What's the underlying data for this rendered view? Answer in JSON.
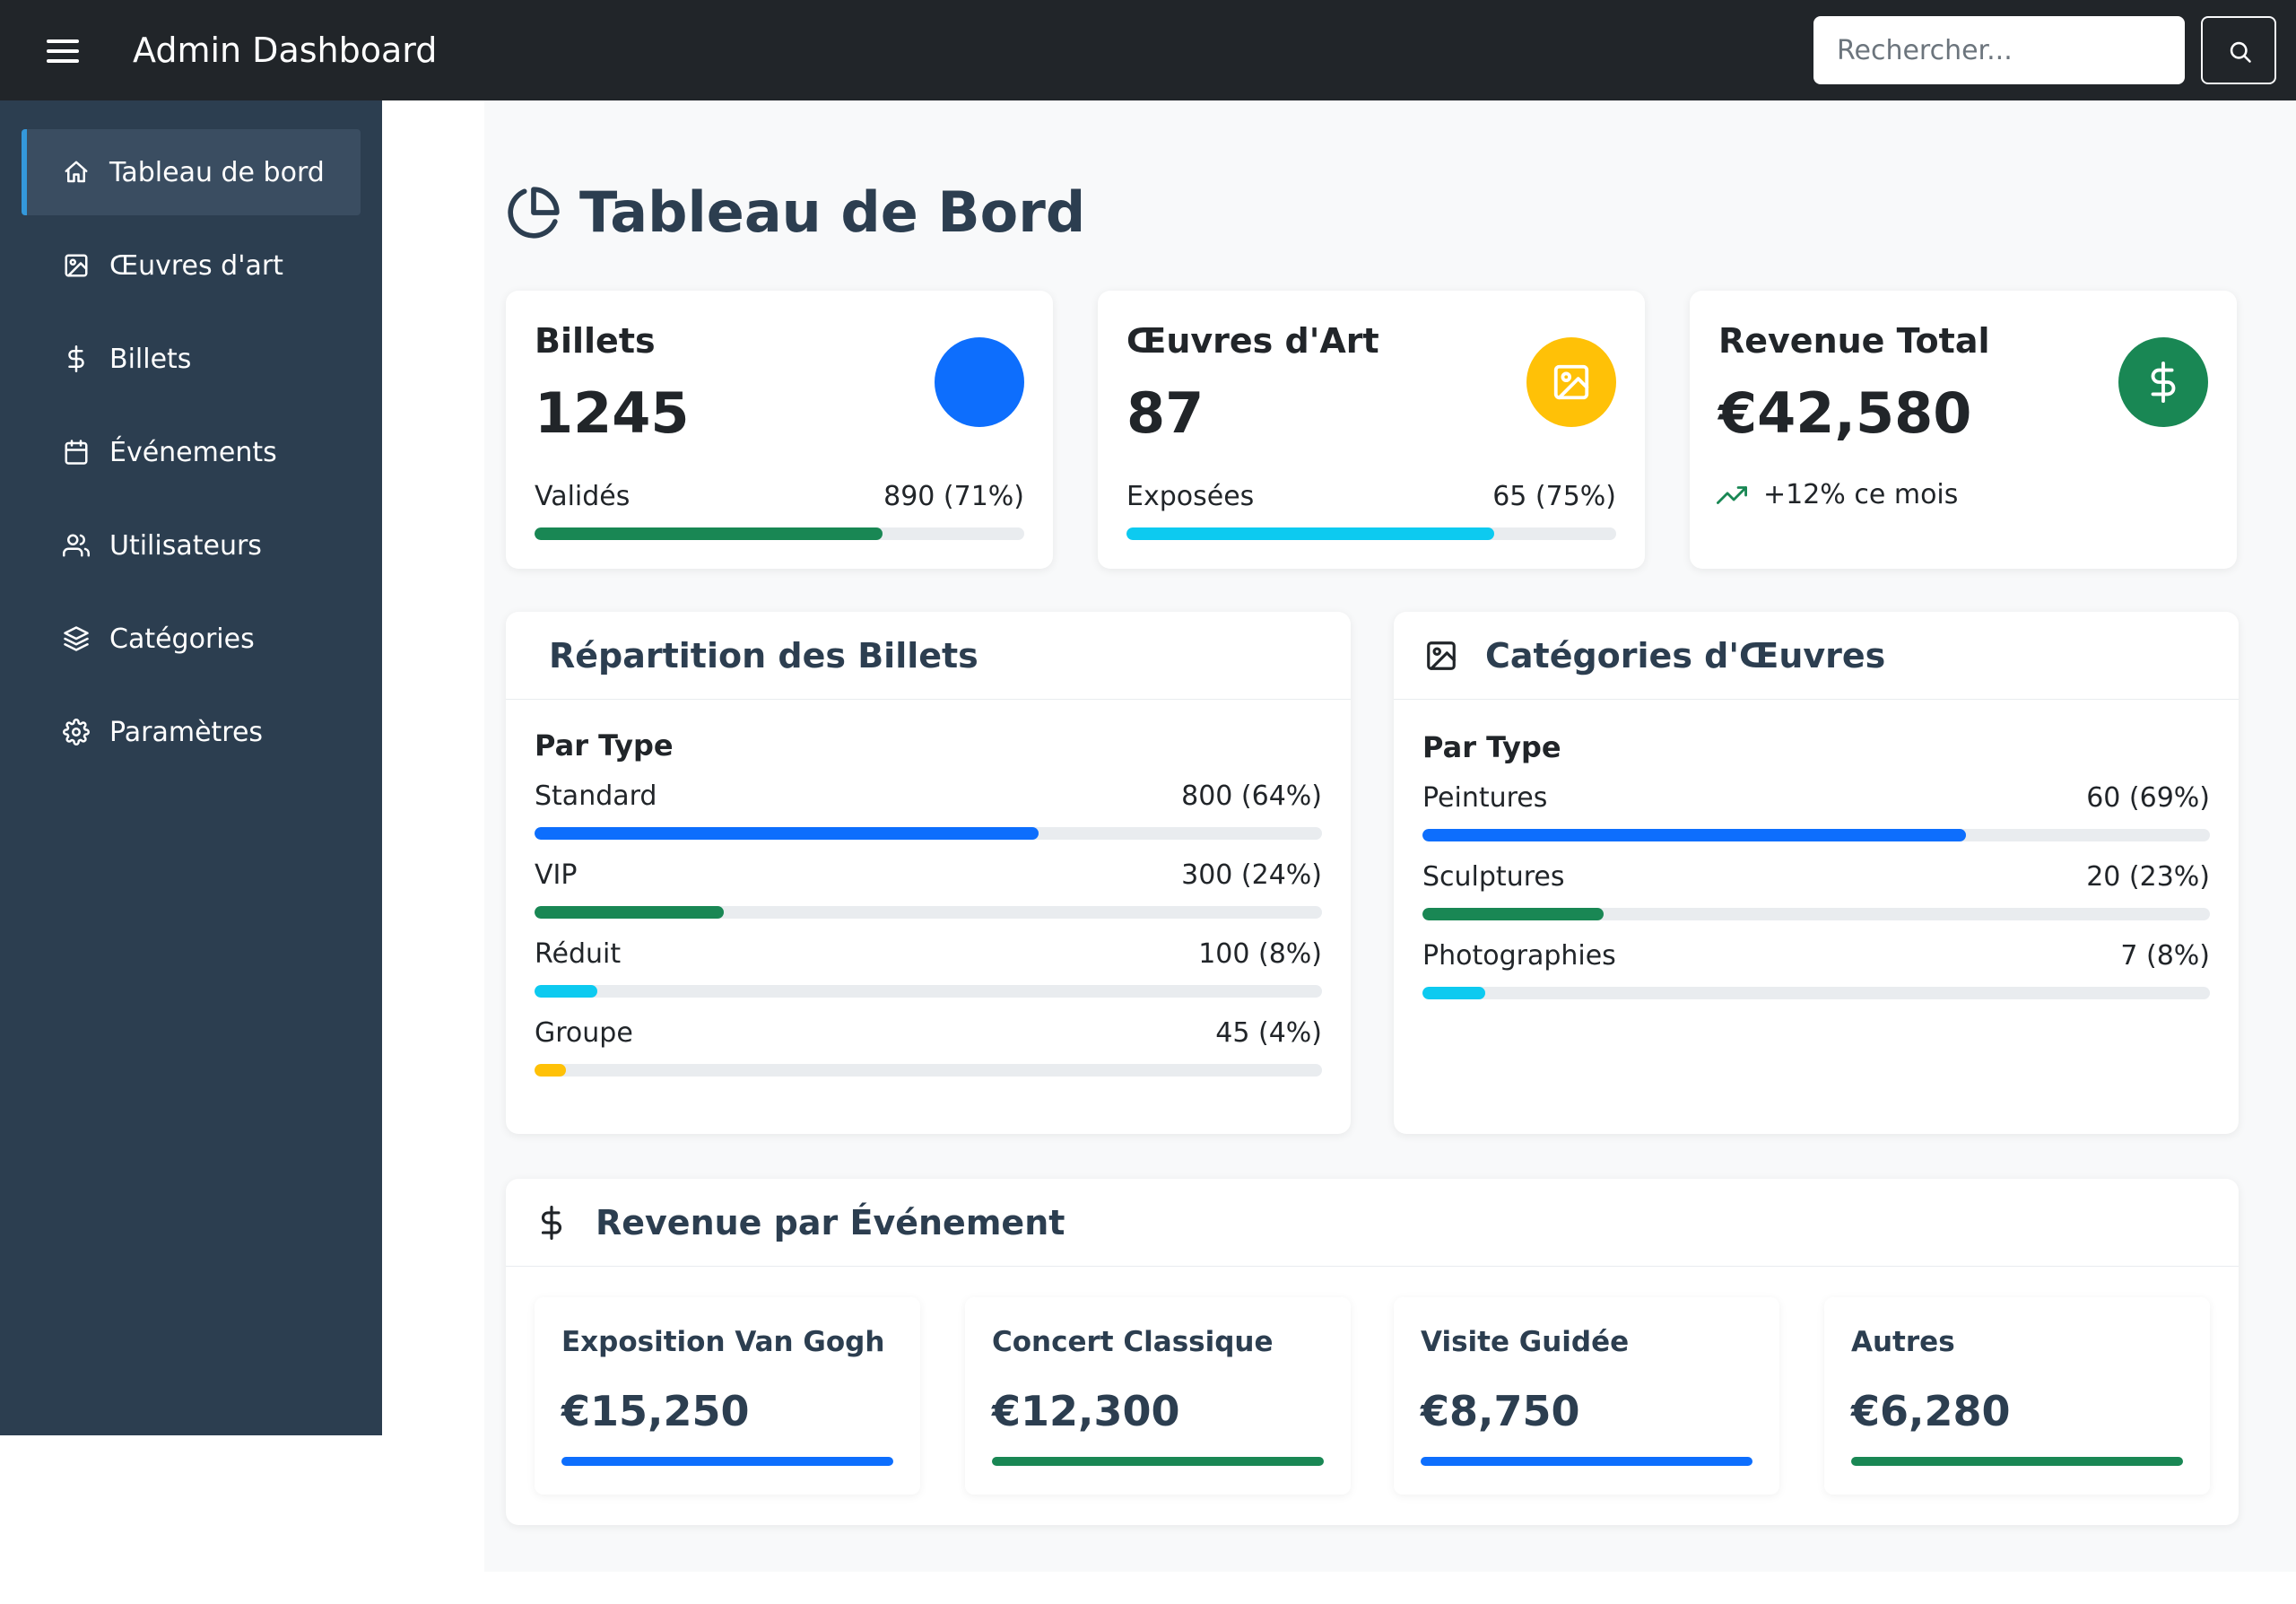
{
  "navbar": {
    "brand": "Admin Dashboard",
    "search_placeholder": "Rechercher..."
  },
  "sidebar": {
    "items": [
      {
        "label": "Tableau de bord",
        "icon": "home-icon",
        "active": true
      },
      {
        "label": "Œuvres d'art",
        "icon": "image-icon",
        "active": false
      },
      {
        "label": "Billets",
        "icon": "dollar-icon",
        "active": false
      },
      {
        "label": "Événements",
        "icon": "calendar-icon",
        "active": false
      },
      {
        "label": "Utilisateurs",
        "icon": "users-icon",
        "active": false
      },
      {
        "label": "Catégories",
        "icon": "layers-icon",
        "active": false
      },
      {
        "label": "Paramètres",
        "icon": "gear-icon",
        "active": false
      }
    ]
  },
  "page": {
    "title": "Tableau de Bord",
    "title_icon": "pie-chart-icon"
  },
  "stats": [
    {
      "title": "Billets",
      "value": "1245",
      "label": "Validés",
      "detail": "890 (71%)",
      "percent": 71,
      "color": "#198754",
      "circle_color": "#0d6efd",
      "icon": "ticket-icon"
    },
    {
      "title": "Œuvres d'Art",
      "value": "87",
      "label": "Exposées",
      "detail": "65 (75%)",
      "percent": 75,
      "color": "#0dcaf0",
      "circle_color": "#ffc107",
      "icon": "image-icon"
    },
    {
      "title": "Revenue Total",
      "value": "€42,580",
      "trend": "+12% ce mois",
      "circle_color": "#198754",
      "icon": "dollar-icon",
      "trend_icon": "trending-up-icon"
    }
  ],
  "tickets_breakdown": {
    "title": "Répartition des Billets",
    "subtitle": "Par Type",
    "rows": [
      {
        "label": "Standard",
        "value": "800 (64%)",
        "percent": 64,
        "color": "#0d6efd"
      },
      {
        "label": "VIP",
        "value": "300 (24%)",
        "percent": 24,
        "color": "#198754"
      },
      {
        "label": "Réduit",
        "value": "100 (8%)",
        "percent": 8,
        "color": "#0dcaf0"
      },
      {
        "label": "Groupe",
        "value": "45 (4%)",
        "percent": 4,
        "color": "#ffc107"
      }
    ]
  },
  "art_categories": {
    "title": "Catégories d'Œuvres",
    "subtitle": "Par Type",
    "rows": [
      {
        "label": "Peintures",
        "value": "60 (69%)",
        "percent": 69,
        "color": "#0d6efd"
      },
      {
        "label": "Sculptures",
        "value": "20 (23%)",
        "percent": 23,
        "color": "#198754"
      },
      {
        "label": "Photographies",
        "value": "7 (8%)",
        "percent": 8,
        "color": "#0dcaf0"
      }
    ]
  },
  "revenue_events": {
    "title": "Revenue par Événement",
    "events": [
      {
        "name": "Exposition Van Gogh",
        "amount": "€15,250",
        "color": "#0d6efd"
      },
      {
        "name": "Concert Classique",
        "amount": "€12,300",
        "color": "#198754"
      },
      {
        "name": "Visite Guidée",
        "amount": "€8,750",
        "color": "#0d6efd"
      },
      {
        "name": "Autres",
        "amount": "€6,280",
        "color": "#198754"
      }
    ]
  }
}
